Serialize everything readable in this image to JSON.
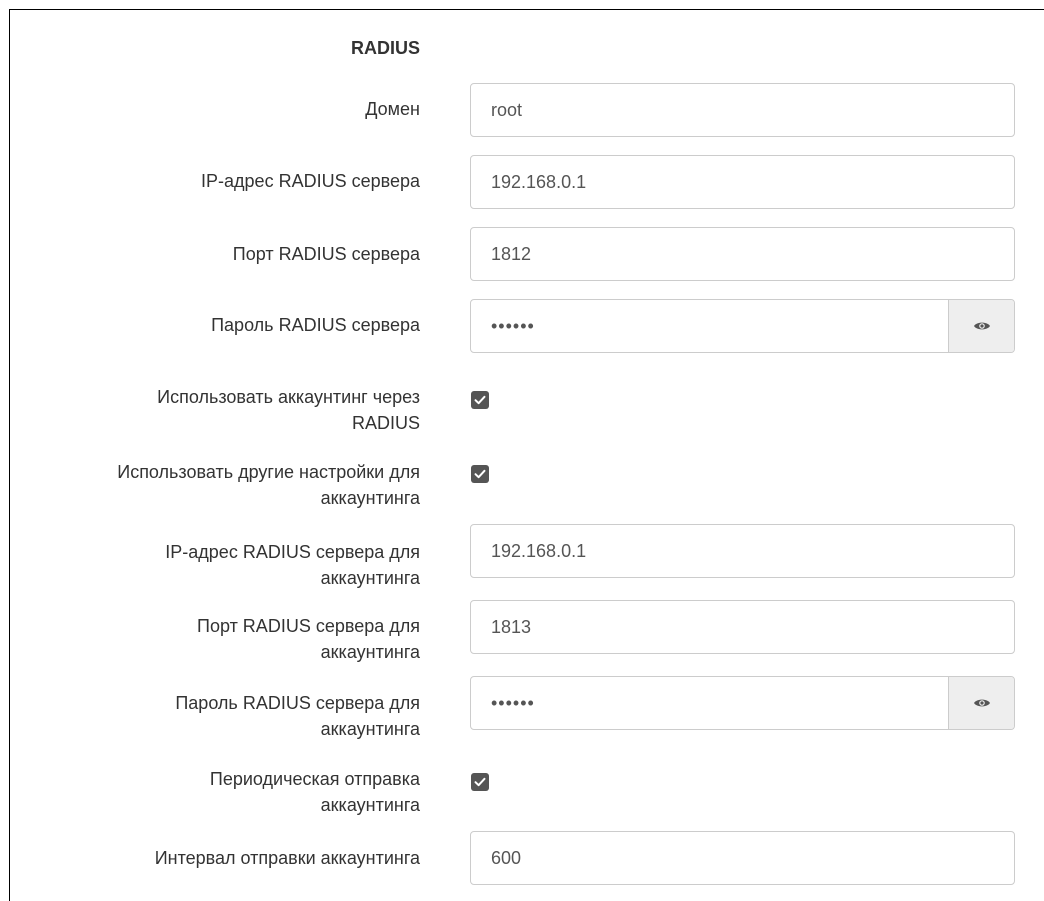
{
  "section": {
    "title": "RADIUS"
  },
  "fields": {
    "domain": {
      "label": "Домен",
      "value": "root"
    },
    "server_ip": {
      "label": "IP-адрес RADIUS сервера",
      "value": "192.168.0.1"
    },
    "server_port": {
      "label": "Порт RADIUS сервера",
      "value": "1812"
    },
    "server_password": {
      "label": "Пароль RADIUS сервера",
      "masked_value": "••••••"
    },
    "use_accounting": {
      "label_line1": "Использовать аккаунтинг через",
      "label_line2": "RADIUS",
      "checked": true
    },
    "use_other_settings": {
      "label_line1": "Использовать другие настройки для",
      "label_line2": "аккаунтинга",
      "checked": true
    },
    "acct_ip": {
      "label_line1": "IP-адрес RADIUS сервера для",
      "label_line2": "аккаунтинга",
      "value": "192.168.0.1"
    },
    "acct_port": {
      "label_line1": "Порт RADIUS сервера для",
      "label_line2": "аккаунтинга",
      "value": "1813"
    },
    "acct_password": {
      "label_line1": "Пароль RADIUS сервера для",
      "label_line2": "аккаунтинга",
      "masked_value": "••••••"
    },
    "periodic_accounting": {
      "label_line1": "Периодическая отправка",
      "label_line2": "аккаунтинга",
      "checked": true
    },
    "acct_interval": {
      "label": "Интервал отправки аккаунтинга",
      "value": "600"
    }
  },
  "icons": {
    "show_password": "eye-icon",
    "checkbox": "checkmark-icon"
  },
  "colors": {
    "checkbox_fill": "#555555",
    "eye_button_bg": "#eeeeee",
    "input_border": "#cccccc"
  }
}
